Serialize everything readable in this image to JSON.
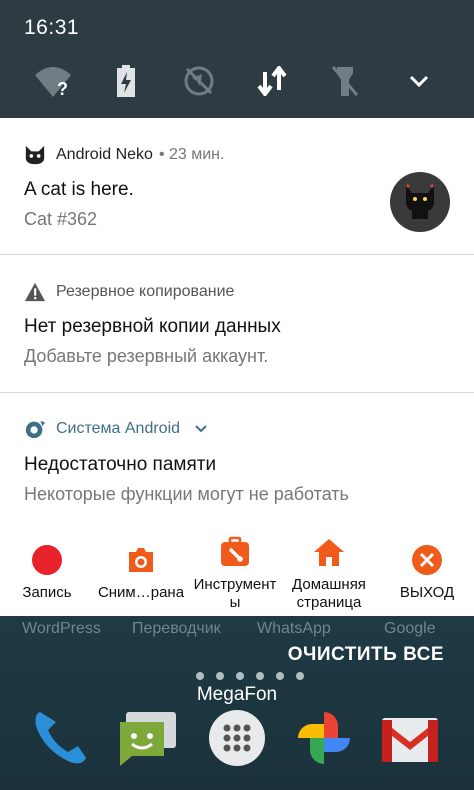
{
  "status_bar": {
    "time": "16:31"
  },
  "quick_settings": {
    "icons": [
      "wifi-unknown-icon",
      "battery-charging-icon",
      "location-off-icon",
      "data-transfer-icon",
      "flashlight-off-icon",
      "expand-chevron-icon"
    ]
  },
  "notifications": [
    {
      "app": "Android Neko",
      "time": "• 23 мин.",
      "title": "A cat is here.",
      "text": "Cat #362",
      "app_icon": "cat-icon",
      "large_icon": "cat-avatar-icon"
    },
    {
      "app": "Резервное копирование",
      "title": "Нет резервной копии данных",
      "text": "Добавьте резервный аккаунт.",
      "app_icon": "warning-icon"
    },
    {
      "app": "Система Android",
      "title": "Недостаточно памяти",
      "text": "Некоторые функции могут не работать",
      "app_icon": "android-system-icon",
      "expand_icon": "chevron-down-icon"
    }
  ],
  "toolbar": {
    "items": [
      {
        "label": "Запись",
        "icon": "record-icon",
        "color": "#e8222a"
      },
      {
        "label": "Сним…рана",
        "icon": "camera-icon",
        "color": "#f05a1a"
      },
      {
        "label": "Инструменты",
        "icon": "toolbox-icon",
        "color": "#f05a1a"
      },
      {
        "label": "Домашняя страница",
        "icon": "home-icon",
        "color": "#f05a1a"
      },
      {
        "label": "ВЫХОД",
        "icon": "close-icon",
        "color": "#f05a1a"
      }
    ]
  },
  "home_screen": {
    "app_labels": [
      "WordPress",
      "Переводчик",
      "WhatsApp",
      "Google"
    ],
    "clear_all": "ОЧИСТИТЬ ВСЕ",
    "carrier": "MegaFon",
    "dock": [
      "phone-icon",
      "messages-icon",
      "apps-drawer-icon",
      "photos-icon",
      "gmail-icon"
    ]
  }
}
